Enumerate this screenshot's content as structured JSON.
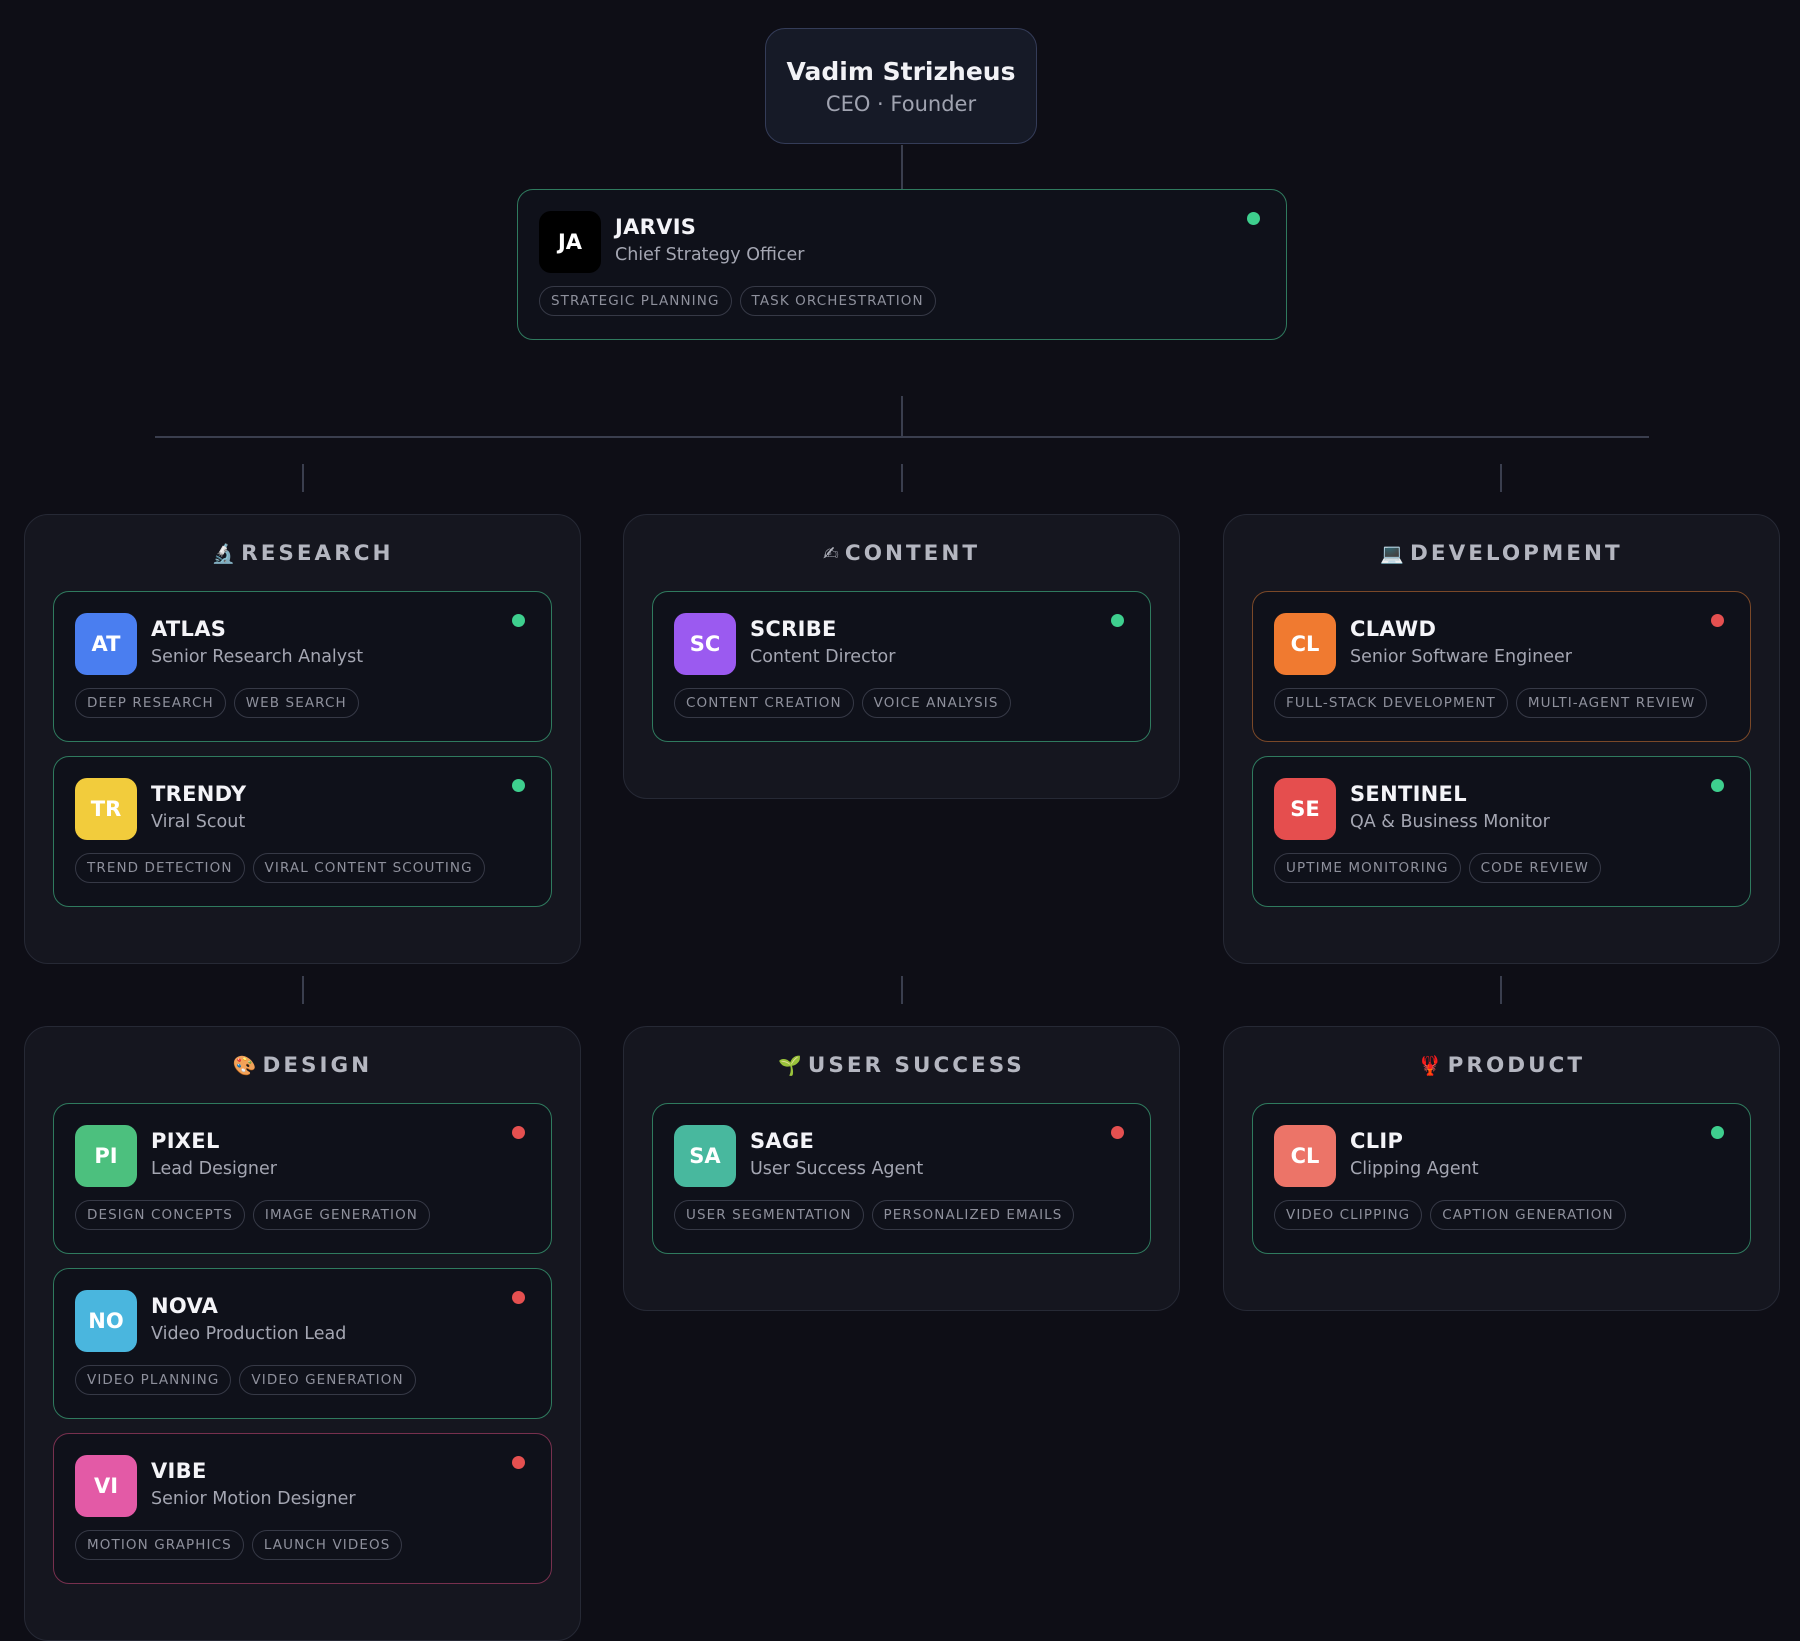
{
  "ceo": {
    "name": "Vadim Strizheus",
    "title": "CEO · Founder"
  },
  "cso": {
    "initials": "JA",
    "name": "JARVIS",
    "role": "Chief Strategy Officer",
    "avatar_color": "#000000",
    "status_color": "#3ecf8e",
    "tags": [
      "STRATEGIC PLANNING",
      "TASK ORCHESTRATION"
    ]
  },
  "departments": [
    {
      "name": "RESEARCH",
      "icon": "🔬",
      "icon_name": "microscope-icon",
      "agents": [
        {
          "initials": "AT",
          "name": "ATLAS",
          "role": "Senior Research Analyst",
          "avatar_color": "#4a7ef0",
          "status_color": "#3ecf8e",
          "border": "ok",
          "tags": [
            "DEEP RESEARCH",
            "WEB SEARCH"
          ]
        },
        {
          "initials": "TR",
          "name": "TRENDY",
          "role": "Viral Scout",
          "avatar_color": "#f2cc3c",
          "status_color": "#3ecf8e",
          "border": "ok",
          "tags": [
            "TREND DETECTION",
            "VIRAL CONTENT SCOUTING"
          ]
        }
      ]
    },
    {
      "name": "CONTENT",
      "icon": "✍",
      "icon_name": "writing-hand-icon",
      "agents": [
        {
          "initials": "SC",
          "name": "SCRIBE",
          "role": "Content Director",
          "avatar_color": "#9b5af0",
          "status_color": "#3ecf8e",
          "border": "ok",
          "tags": [
            "CONTENT CREATION",
            "VOICE ANALYSIS"
          ]
        }
      ]
    },
    {
      "name": "DEVELOPMENT",
      "icon": "💻",
      "icon_name": "laptop-icon",
      "agents": [
        {
          "initials": "CL",
          "name": "CLAWD",
          "role": "Senior Software Engineer",
          "avatar_color": "#f07a30",
          "status_color": "#e55050",
          "border": "warn",
          "tags": [
            "FULL-STACK DEVELOPMENT",
            "MULTI-AGENT REVIEW"
          ]
        },
        {
          "initials": "SE",
          "name": "SENTINEL",
          "role": "QA & Business Monitor",
          "avatar_color": "#e54e4e",
          "status_color": "#3ecf8e",
          "border": "ok",
          "tags": [
            "UPTIME MONITORING",
            "CODE REVIEW"
          ]
        }
      ]
    },
    {
      "name": "DESIGN",
      "icon": "🎨",
      "icon_name": "palette-icon",
      "agents": [
        {
          "initials": "PI",
          "name": "PIXEL",
          "role": "Lead Designer",
          "avatar_color": "#4cc07e",
          "status_color": "#e55050",
          "border": "ok",
          "tags": [
            "DESIGN CONCEPTS",
            "IMAGE GENERATION"
          ]
        },
        {
          "initials": "NO",
          "name": "NOVA",
          "role": "Video Production Lead",
          "avatar_color": "#4ab6de",
          "status_color": "#e55050",
          "border": "ok",
          "tags": [
            "VIDEO PLANNING",
            "VIDEO GENERATION"
          ]
        },
        {
          "initials": "VI",
          "name": "VIBE",
          "role": "Senior Motion Designer",
          "avatar_color": "#e35aa6",
          "status_color": "#e55050",
          "border": "pink",
          "tags": [
            "MOTION GRAPHICS",
            "LAUNCH VIDEOS"
          ]
        }
      ]
    },
    {
      "name": "USER SUCCESS",
      "icon": "🌱",
      "icon_name": "seedling-icon",
      "agents": [
        {
          "initials": "SA",
          "name": "SAGE",
          "role": "User Success Agent",
          "avatar_color": "#48b89e",
          "status_color": "#e55050",
          "border": "ok",
          "tags": [
            "USER SEGMENTATION",
            "PERSONALIZED EMAILS"
          ]
        }
      ]
    },
    {
      "name": "PRODUCT",
      "icon": "🦞",
      "icon_name": "lobster-icon",
      "agents": [
        {
          "initials": "CL",
          "name": "CLIP",
          "role": "Clipping Agent",
          "avatar_color": "#ec7468",
          "status_color": "#3ecf8e",
          "border": "ok",
          "tags": [
            "VIDEO CLIPPING",
            "CAPTION GENERATION"
          ]
        }
      ]
    }
  ]
}
